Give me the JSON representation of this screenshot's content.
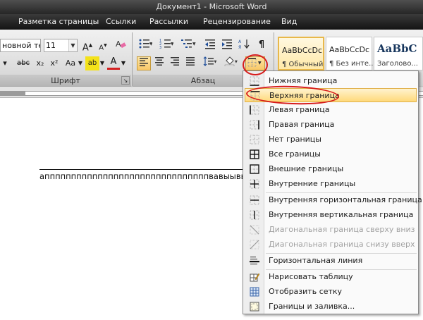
{
  "window": {
    "title": "Документ1 - Microsoft Word"
  },
  "tabs": [
    {
      "label": "Разметка страницы"
    },
    {
      "label": "Ссылки"
    },
    {
      "label": "Рассылки"
    },
    {
      "label": "Рецензирование"
    },
    {
      "label": "Вид"
    }
  ],
  "ribbon": {
    "font": {
      "group_label": "Шрифт",
      "font_name": "новной те",
      "font_size": "11",
      "buttons": {
        "strike": "abc",
        "subscript": "x₂",
        "superscript": "x²",
        "change_case": "Aa",
        "highlight": "ab",
        "font_color": "A"
      }
    },
    "paragraph": {
      "group_label": "Абзац"
    },
    "styles": [
      {
        "sample": "AaBbCcDc",
        "name": "¶ Обычный"
      },
      {
        "sample": "AaBbCcDc",
        "name": "¶ Без инте..."
      },
      {
        "sample": "AaBbC",
        "name": "Заголово..."
      }
    ]
  },
  "document": {
    "text": "апппппппппппппппппппппппппппппппвавыывыв"
  },
  "borders_menu": {
    "items": [
      {
        "label": "Нижняя граница",
        "icon": "border-bottom-icon"
      },
      {
        "label": "Верхняя граница",
        "icon": "border-top-icon"
      },
      {
        "label": "Левая граница",
        "icon": "border-left-icon"
      },
      {
        "label": "Правая граница",
        "icon": "border-right-icon"
      },
      {
        "label": "Нет границы",
        "icon": "border-none-icon"
      },
      {
        "label": "Все границы",
        "icon": "border-all-icon"
      },
      {
        "label": "Внешние границы",
        "icon": "border-outside-icon"
      },
      {
        "label": "Внутренние границы",
        "icon": "border-inside-icon"
      },
      {
        "label": "Внутренняя горизонтальная граница",
        "icon": "border-inside-horizontal-icon"
      },
      {
        "label": "Внутренняя вертикальная граница",
        "icon": "border-inside-vertical-icon"
      },
      {
        "label": "Диагональная граница сверху вниз",
        "icon": "border-diagonal-down-icon"
      },
      {
        "label": "Диагональная граница снизу вверх",
        "icon": "border-diagonal-up-icon"
      },
      {
        "label": "Горизонтальная линия",
        "icon": "horizontal-line-icon"
      },
      {
        "label": "Нарисовать таблицу",
        "icon": "draw-table-icon"
      },
      {
        "label": "Отобразить сетку",
        "icon": "view-gridlines-icon"
      },
      {
        "label": "Границы и заливка...",
        "icon": "borders-shading-icon"
      }
    ]
  },
  "colors": {
    "annotation": "#d71b1b",
    "highlight": "#ffd97a",
    "font_color": "#d42020",
    "highlight_color": "#f4e21a"
  }
}
